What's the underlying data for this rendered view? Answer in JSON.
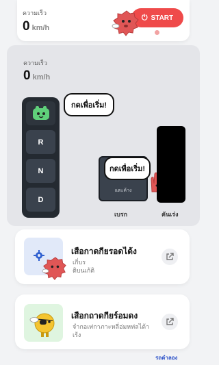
{
  "speed_card_top": {
    "label": "ความเร็ว",
    "value": "0",
    "unit": "km/h"
  },
  "start_button": {
    "label": "START",
    "icon": "power-icon"
  },
  "speed_card_main": {
    "label": "ความเร็ว",
    "value": "0",
    "unit": "km/h"
  },
  "gears": [
    "R",
    "N",
    "D"
  ],
  "bubbles": {
    "gear_hint": "กดเพื่อเริ่ม!",
    "brake_hint": "กดเพื่อเริ่ม!"
  },
  "pedals": {
    "brake_inner": "แตะค้าง",
    "brake_label": "เบรก",
    "accel_label": "คันเร่ง"
  },
  "cards": [
    {
      "title": "เสือกาดกียรอดได้ง",
      "subtitle_lines": [
        "เกี่บร",
        "ติบนเก้ติ"
      ],
      "icon": "gear-icon"
    },
    {
      "title": "เสือกถาดกียร์อมดง",
      "subtitle_lines": [
        "จำกอเท่กาภาะหลี่อ่มหท่ลได้า",
        "เร้ง"
      ],
      "icon": "pirate-mascot-icon"
    }
  ],
  "footer_link": "รถดำลอง",
  "colors": {
    "accent_red": "#ef4a4a",
    "panel_bg": "#e4e5e9",
    "dark_pad": "#242a31",
    "gear_btn": "#3a424d"
  }
}
